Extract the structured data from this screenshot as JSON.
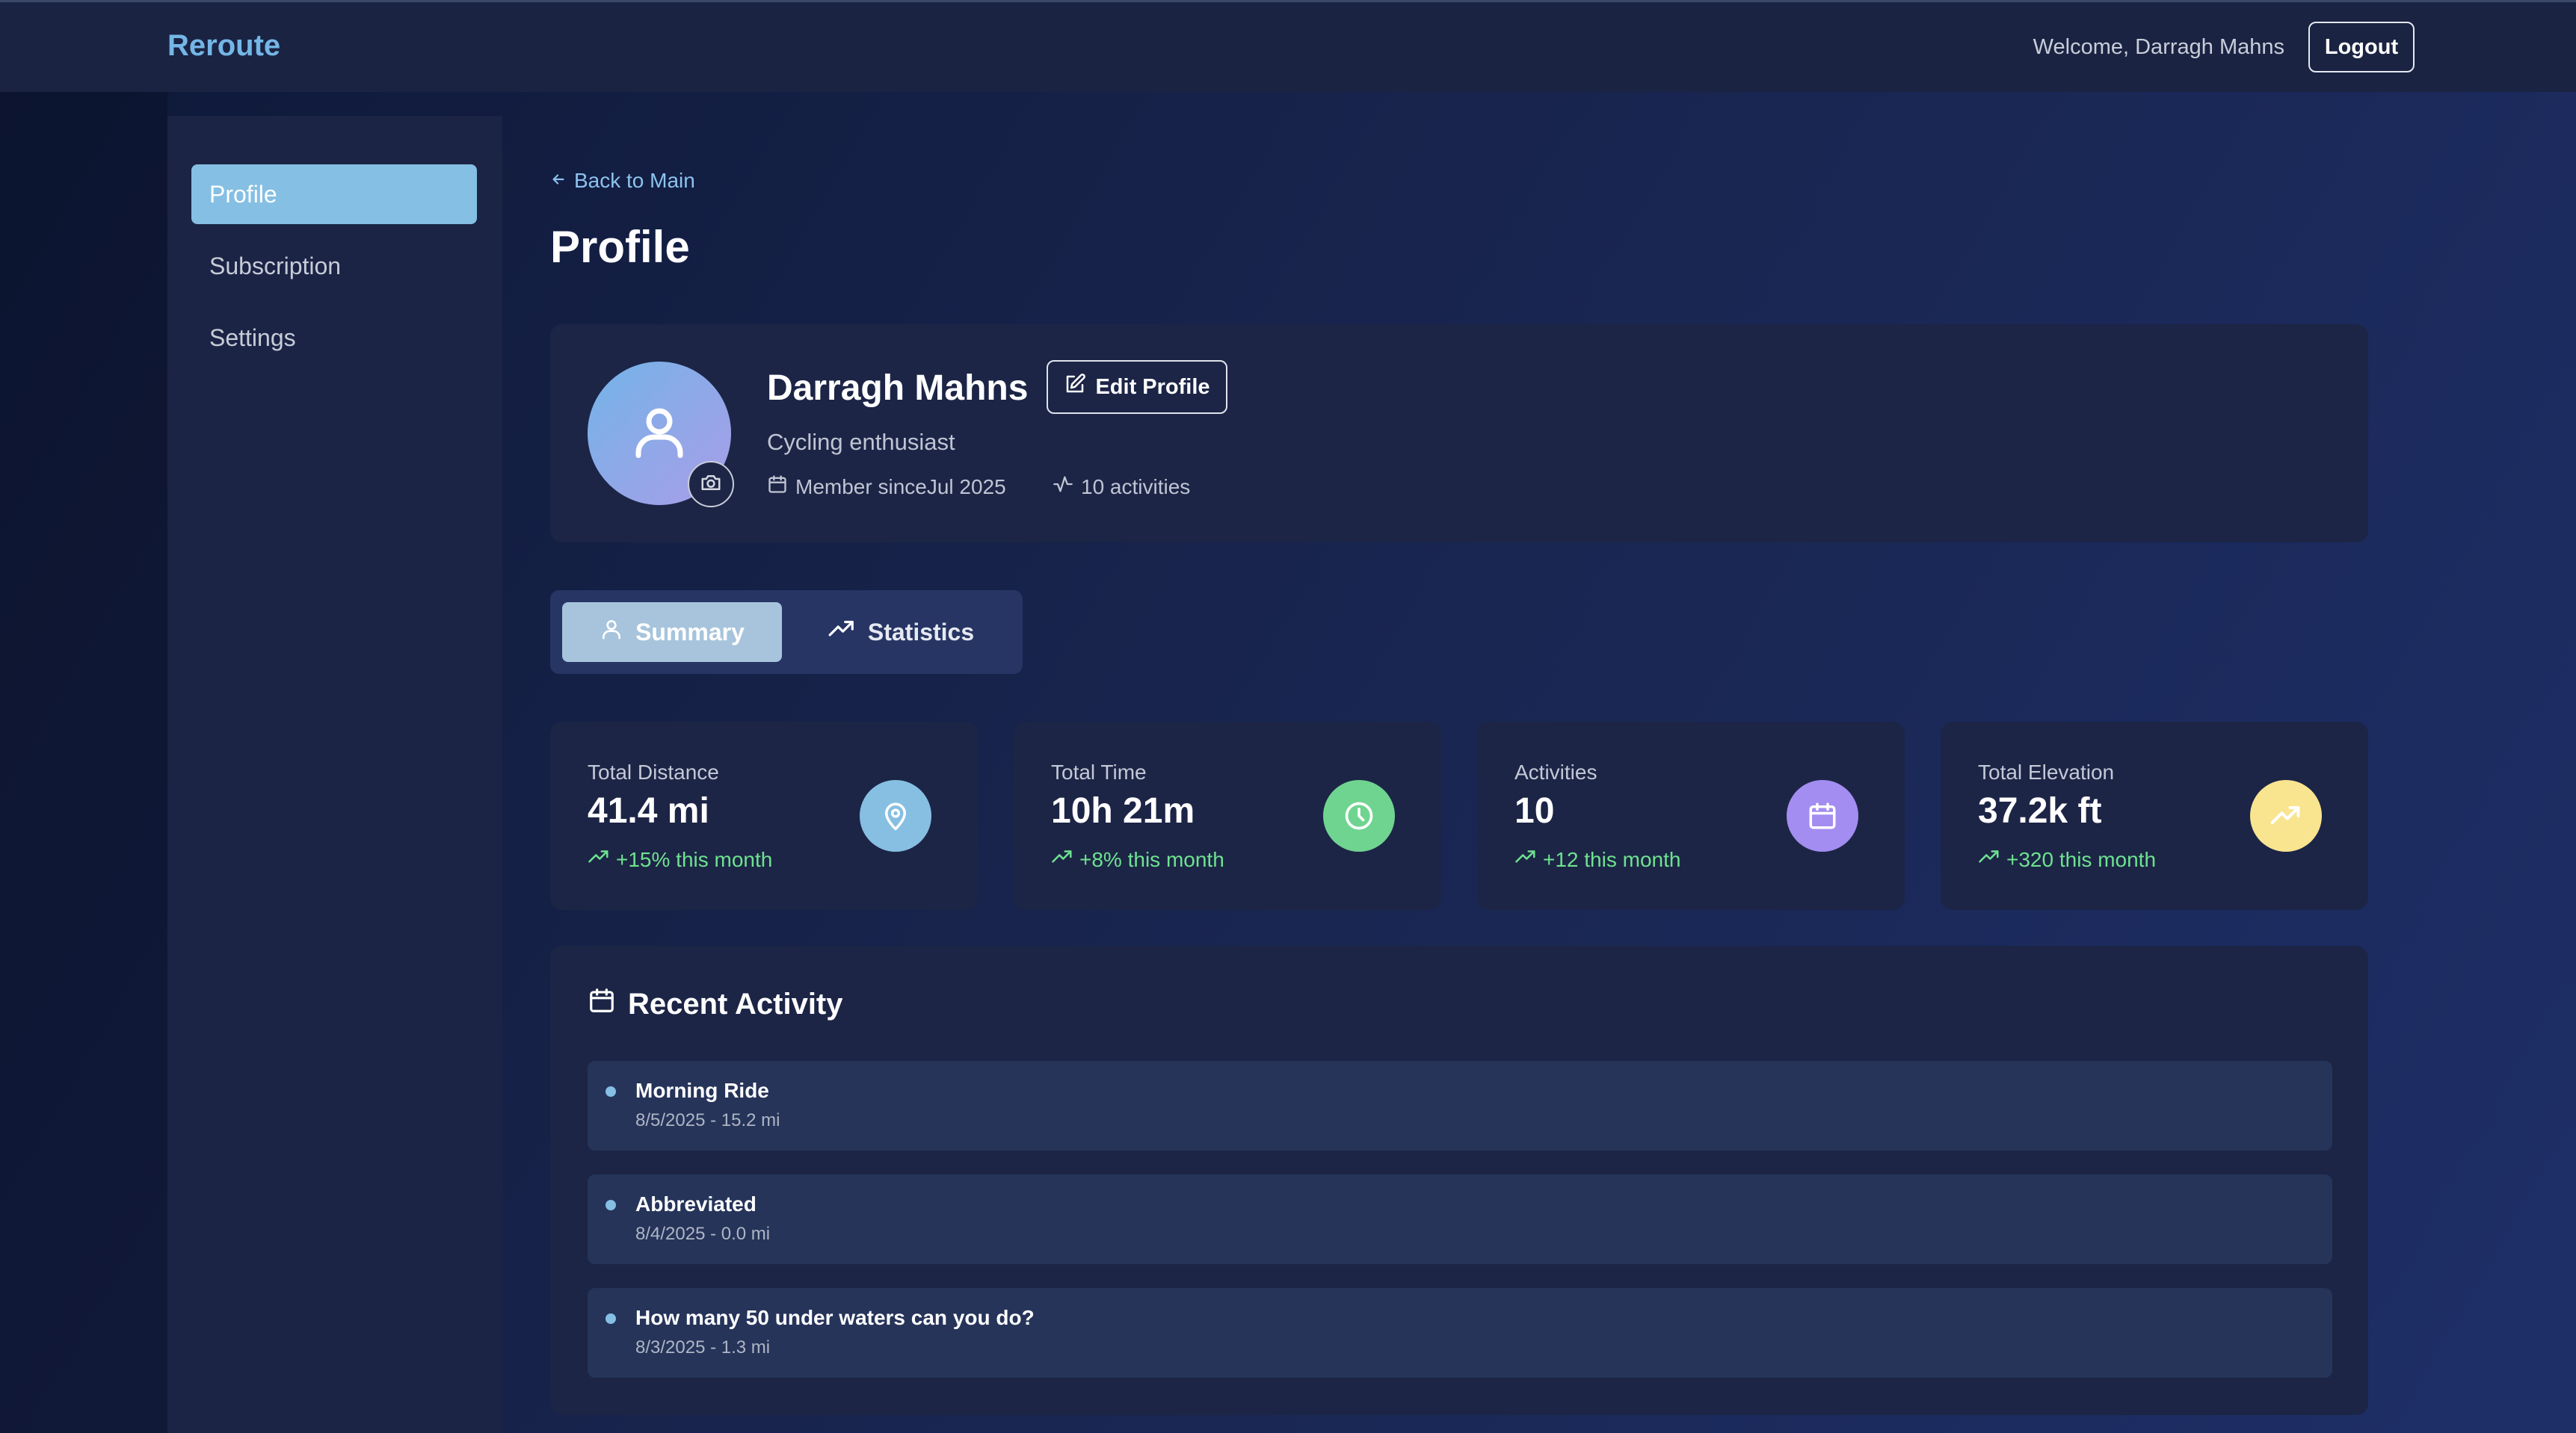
{
  "header": {
    "brand": "Reroute",
    "welcome": "Welcome, Darragh Mahns",
    "logout_label": "Logout"
  },
  "sidebar": {
    "items": [
      {
        "label": "Profile",
        "active": true
      },
      {
        "label": "Subscription",
        "active": false
      },
      {
        "label": "Settings",
        "active": false
      }
    ]
  },
  "main": {
    "back_label": "Back to Main",
    "title": "Profile"
  },
  "profile": {
    "name": "Darragh Mahns",
    "edit_label": "Edit Profile",
    "bio": "Cycling enthusiast",
    "member_since": "Member sinceJul 2025",
    "activities_count": "10 activities"
  },
  "tabs": [
    {
      "label": "Summary",
      "icon": "user-icon",
      "active": true
    },
    {
      "label": "Statistics",
      "icon": "trending-up-icon",
      "active": false
    }
  ],
  "stats": [
    {
      "label": "Total Distance",
      "value": "41.4 mi",
      "trend": "+15% this month",
      "icon": "map-pin-icon",
      "color": "#86bfe2"
    },
    {
      "label": "Total Time",
      "value": "10h 21m",
      "trend": "+8% this month",
      "icon": "clock-icon",
      "color": "#6fd490"
    },
    {
      "label": "Activities",
      "value": "10",
      "trend": "+12 this month",
      "icon": "calendar-icon",
      "color": "#a38df0"
    },
    {
      "label": "Total Elevation",
      "value": "37.2k ft",
      "trend": "+320 this month",
      "icon": "trending-up-icon",
      "color": "#f9e48f"
    }
  ],
  "recent_activity": {
    "title": "Recent Activity",
    "items": [
      {
        "name": "Morning Ride",
        "details": "8/5/2025 - 15.2 mi"
      },
      {
        "name": "Abbreviated",
        "details": "8/4/2025 - 0.0 mi"
      },
      {
        "name": "How many 50 under waters can you do?",
        "details": "8/3/2025 - 1.3 mi"
      }
    ]
  },
  "colors": {
    "accent": "#85bfe3",
    "brand": "#74b6e6",
    "trend_positive": "#6ee28f",
    "card_bg": "#1c2546"
  }
}
